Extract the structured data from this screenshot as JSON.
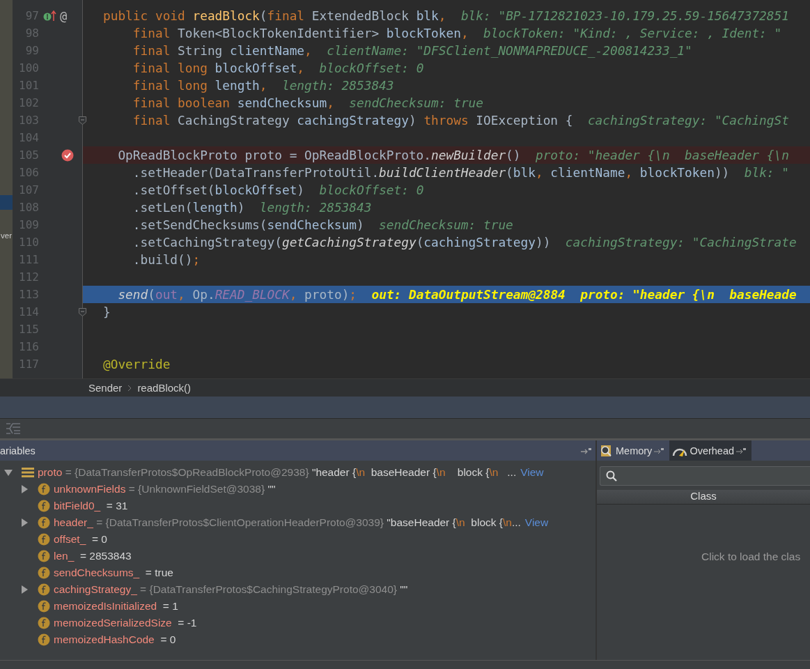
{
  "left_strip": {
    "text": "ver"
  },
  "editor": {
    "lines": [
      {
        "number": "97",
        "implemented": true,
        "gutter_text": "@",
        "tokens": [
          {
            "text": "public void ",
            "kind": "kw"
          },
          {
            "text": "readBlock",
            "kind": "decl"
          },
          {
            "text": "(",
            "kind": "plain"
          },
          {
            "text": "final ",
            "kind": "kw"
          },
          {
            "text": "ExtendedBlock ",
            "kind": "plain"
          },
          {
            "text": "blk",
            "kind": "param"
          },
          {
            "text": ",",
            "kind": "kw"
          },
          {
            "text": "blk: \"BP-1712821023-10.179.25.59-15647372851",
            "kind": "hint"
          }
        ]
      },
      {
        "number": "98",
        "tokens": [
          {
            "text": "    final ",
            "kind": "kw"
          },
          {
            "text": "Token<BlockTokenIdentifier> ",
            "kind": "plain"
          },
          {
            "text": "blockToken",
            "kind": "param"
          },
          {
            "text": ",",
            "kind": "kw"
          },
          {
            "text": "blockToken: \"Kind: , Service: , Ident: \"",
            "kind": "hint"
          }
        ]
      },
      {
        "number": "99",
        "tokens": [
          {
            "text": "    final ",
            "kind": "kw"
          },
          {
            "text": "String ",
            "kind": "plain"
          },
          {
            "text": "clientName",
            "kind": "param"
          },
          {
            "text": ",",
            "kind": "kw"
          },
          {
            "text": "clientName: \"DFSClient_NONMAPREDUCE_-200814233_1\"",
            "kind": "hint"
          }
        ]
      },
      {
        "number": "100",
        "tokens": [
          {
            "text": "    final long ",
            "kind": "kw"
          },
          {
            "text": "blockOffset",
            "kind": "param"
          },
          {
            "text": ",",
            "kind": "kw"
          },
          {
            "text": "blockOffset: 0",
            "kind": "hint"
          }
        ]
      },
      {
        "number": "101",
        "tokens": [
          {
            "text": "    final long ",
            "kind": "kw"
          },
          {
            "text": "length",
            "kind": "param"
          },
          {
            "text": ",",
            "kind": "kw"
          },
          {
            "text": "length: 2853843",
            "kind": "hint"
          }
        ]
      },
      {
        "number": "102",
        "tokens": [
          {
            "text": "    final boolean ",
            "kind": "kw"
          },
          {
            "text": "sendChecksum",
            "kind": "param"
          },
          {
            "text": ",",
            "kind": "kw"
          },
          {
            "text": "sendChecksum: true",
            "kind": "hint"
          }
        ]
      },
      {
        "number": "103",
        "fold": true,
        "tokens": [
          {
            "text": "    final ",
            "kind": "kw"
          },
          {
            "text": "CachingStrategy ",
            "kind": "plain"
          },
          {
            "text": "cachingStrategy",
            "kind": "param"
          },
          {
            "text": ") ",
            "kind": "plain"
          },
          {
            "text": "throws ",
            "kind": "kw"
          },
          {
            "text": "IOException {",
            "kind": "plain"
          },
          {
            "text": "cachingStrategy: \"CachingSt",
            "kind": "hint"
          }
        ]
      },
      {
        "number": "104"
      },
      {
        "number": "105",
        "breakpoint": true,
        "tokens": [
          {
            "text": "  OpReadBlockProto proto = OpReadBlockProto.",
            "kind": "plain"
          },
          {
            "text": "newBuilder",
            "kind": "call"
          },
          {
            "text": "()",
            "kind": "plain"
          },
          {
            "text": "proto: \"header {\\n  baseHeader {\\n",
            "kind": "hint"
          }
        ]
      },
      {
        "number": "106",
        "tokens": [
          {
            "text": "    .setHeader(DataTransferProtoUtil.",
            "kind": "plain"
          },
          {
            "text": "buildClientHeader",
            "kind": "call"
          },
          {
            "text": "(",
            "kind": "plain"
          },
          {
            "text": "blk",
            "kind": "param"
          },
          {
            "text": ", ",
            "kind": "kw"
          },
          {
            "text": "clientName",
            "kind": "param"
          },
          {
            "text": ", ",
            "kind": "kw"
          },
          {
            "text": "blockToken",
            "kind": "param"
          },
          {
            "text": "))",
            "kind": "plain"
          },
          {
            "text": "blk: \"",
            "kind": "hint"
          }
        ]
      },
      {
        "number": "107",
        "tokens": [
          {
            "text": "    .setOffset(",
            "kind": "plain"
          },
          {
            "text": "blockOffset",
            "kind": "param"
          },
          {
            "text": ")",
            "kind": "plain"
          },
          {
            "text": "blockOffset: 0",
            "kind": "hint"
          }
        ]
      },
      {
        "number": "108",
        "tokens": [
          {
            "text": "    .setLen(",
            "kind": "plain"
          },
          {
            "text": "length",
            "kind": "param"
          },
          {
            "text": ")",
            "kind": "plain"
          },
          {
            "text": "length: 2853843",
            "kind": "hint"
          }
        ]
      },
      {
        "number": "109",
        "tokens": [
          {
            "text": "    .setSendChecksums(",
            "kind": "plain"
          },
          {
            "text": "sendChecksum",
            "kind": "param"
          },
          {
            "text": ")",
            "kind": "plain"
          },
          {
            "text": "sendChecksum: true",
            "kind": "hint"
          }
        ]
      },
      {
        "number": "110",
        "tokens": [
          {
            "text": "    .setCachingStrategy(",
            "kind": "plain"
          },
          {
            "text": "getCachingStrategy",
            "kind": "call"
          },
          {
            "text": "(",
            "kind": "plain"
          },
          {
            "text": "cachingStrategy",
            "kind": "param"
          },
          {
            "text": "))",
            "kind": "plain"
          },
          {
            "text": "cachingStrategy: \"CachingStrate",
            "kind": "hint"
          }
        ]
      },
      {
        "number": "111",
        "tokens": [
          {
            "text": "    .build()",
            "kind": "plain"
          },
          {
            "text": ";",
            "kind": "kw"
          }
        ]
      },
      {
        "number": "112"
      },
      {
        "number": "113",
        "current": true,
        "tokens": [
          {
            "text": "  send",
            "kind": "call"
          },
          {
            "text": "(",
            "kind": "plain"
          },
          {
            "text": "out",
            "kind": "field"
          },
          {
            "text": ", ",
            "kind": "kw"
          },
          {
            "text": "Op.",
            "kind": "plain"
          },
          {
            "text": "READ_BLOCK",
            "kind": "const"
          },
          {
            "text": ", ",
            "kind": "kw"
          },
          {
            "text": "proto)",
            "kind": "plain"
          },
          {
            "text": ";",
            "kind": "kw"
          },
          {
            "text": "out: DataOutputStream@2884",
            "kind": "exec"
          },
          {
            "text": "proto: \"header {\\n  baseHeade",
            "kind": "exec"
          }
        ]
      },
      {
        "number": "114",
        "fold": true,
        "tokens": [
          {
            "text": "}",
            "kind": "plain"
          }
        ]
      },
      {
        "number": "115"
      },
      {
        "number": "116"
      },
      {
        "number": "117",
        "tokens": [
          {
            "text": "@Override",
            "kind": "anno"
          }
        ]
      }
    ]
  },
  "breadcrumb": [
    "Sender",
    "readBlock()"
  ],
  "variables": {
    "title": "ariables",
    "tree": [
      {
        "kind": "object",
        "name": "proto",
        "ref": "= {DataTransferProtos$OpReadBlockProto@2938}",
        "value": "\"header {\\n  baseHeader {\\n    block {\\n   ...",
        "link": "View",
        "expandable": true,
        "expanded": true,
        "children": [
          {
            "kind": "field",
            "name": "unknownFields",
            "ref": "= {UnknownFieldSet@3038}",
            "value": "\"\"",
            "expandable": true,
            "expanded": false
          },
          {
            "kind": "field",
            "name": "bitField0_",
            "value": "= 31",
            "expandable": false
          },
          {
            "kind": "field",
            "name": "header_",
            "ref": "= {DataTransferProtos$ClientOperationHeaderProto@3039}",
            "value": "\"baseHeader {\\n  block {\\n...",
            "link": "View",
            "expandable": true,
            "expanded": false
          },
          {
            "kind": "field",
            "name": "offset_",
            "value": "= 0",
            "expandable": false
          },
          {
            "kind": "field",
            "name": "len_",
            "value": "= 2853843",
            "expandable": false
          },
          {
            "kind": "field",
            "name": "sendChecksums_",
            "value": "= true",
            "expandable": false
          },
          {
            "kind": "field",
            "name": "cachingStrategy_",
            "ref": "= {DataTransferProtos$CachingStrategyProto@3040}",
            "value": "\"\"",
            "expandable": true,
            "expanded": false
          },
          {
            "kind": "field",
            "name": "memoizedIsInitialized",
            "value": "= 1",
            "expandable": false
          },
          {
            "kind": "field",
            "name": "memoizedSerializedSize",
            "value": "= -1",
            "expandable": false
          },
          {
            "kind": "field",
            "name": "memoizedHashCode",
            "value": "= 0",
            "expandable": false
          }
        ]
      }
    ]
  },
  "memory": {
    "tabs": [
      {
        "label": "Memory",
        "selected": false
      },
      {
        "label": "Overhead",
        "selected": true
      }
    ],
    "column": "Class",
    "message": "Click to load the clas"
  }
}
